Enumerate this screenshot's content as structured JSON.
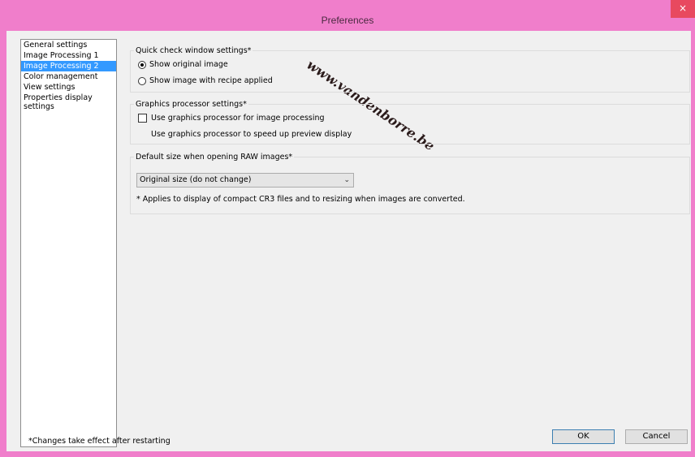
{
  "window": {
    "title": "Preferences",
    "close_glyph": "×",
    "watermark": "www.vandenborre.be"
  },
  "sidebar": {
    "items": [
      {
        "label": "General settings",
        "selected": false
      },
      {
        "label": "Image Processing 1",
        "selected": false
      },
      {
        "label": "Image Processing 2",
        "selected": true
      },
      {
        "label": "Color management",
        "selected": false
      },
      {
        "label": "View settings",
        "selected": false
      },
      {
        "label": "Properties display\nsettings",
        "selected": false
      }
    ]
  },
  "quick_check": {
    "label": "Quick check window settings*",
    "options": [
      {
        "label": "Show original image",
        "checked": true
      },
      {
        "label": "Show image with recipe applied",
        "checked": false
      }
    ]
  },
  "graphics": {
    "label": "Graphics processor settings*",
    "checkbox_label": "Use graphics processor for image processing",
    "checked": false,
    "preview_label": "Use graphics processor to speed up preview display"
  },
  "raw_size": {
    "label": "Default size when opening RAW images*",
    "selected_value": "Original size (do not change)",
    "note": "* Applies to display of compact CR3 files and to resizing when images are converted."
  },
  "footer": {
    "note": "*Changes take effect after restarting",
    "ok_label": "OK",
    "cancel_label": "Cancel"
  },
  "colors": {
    "titlebar": "#f07ecb",
    "selection": "#3399ff",
    "close": "#e8495f"
  }
}
